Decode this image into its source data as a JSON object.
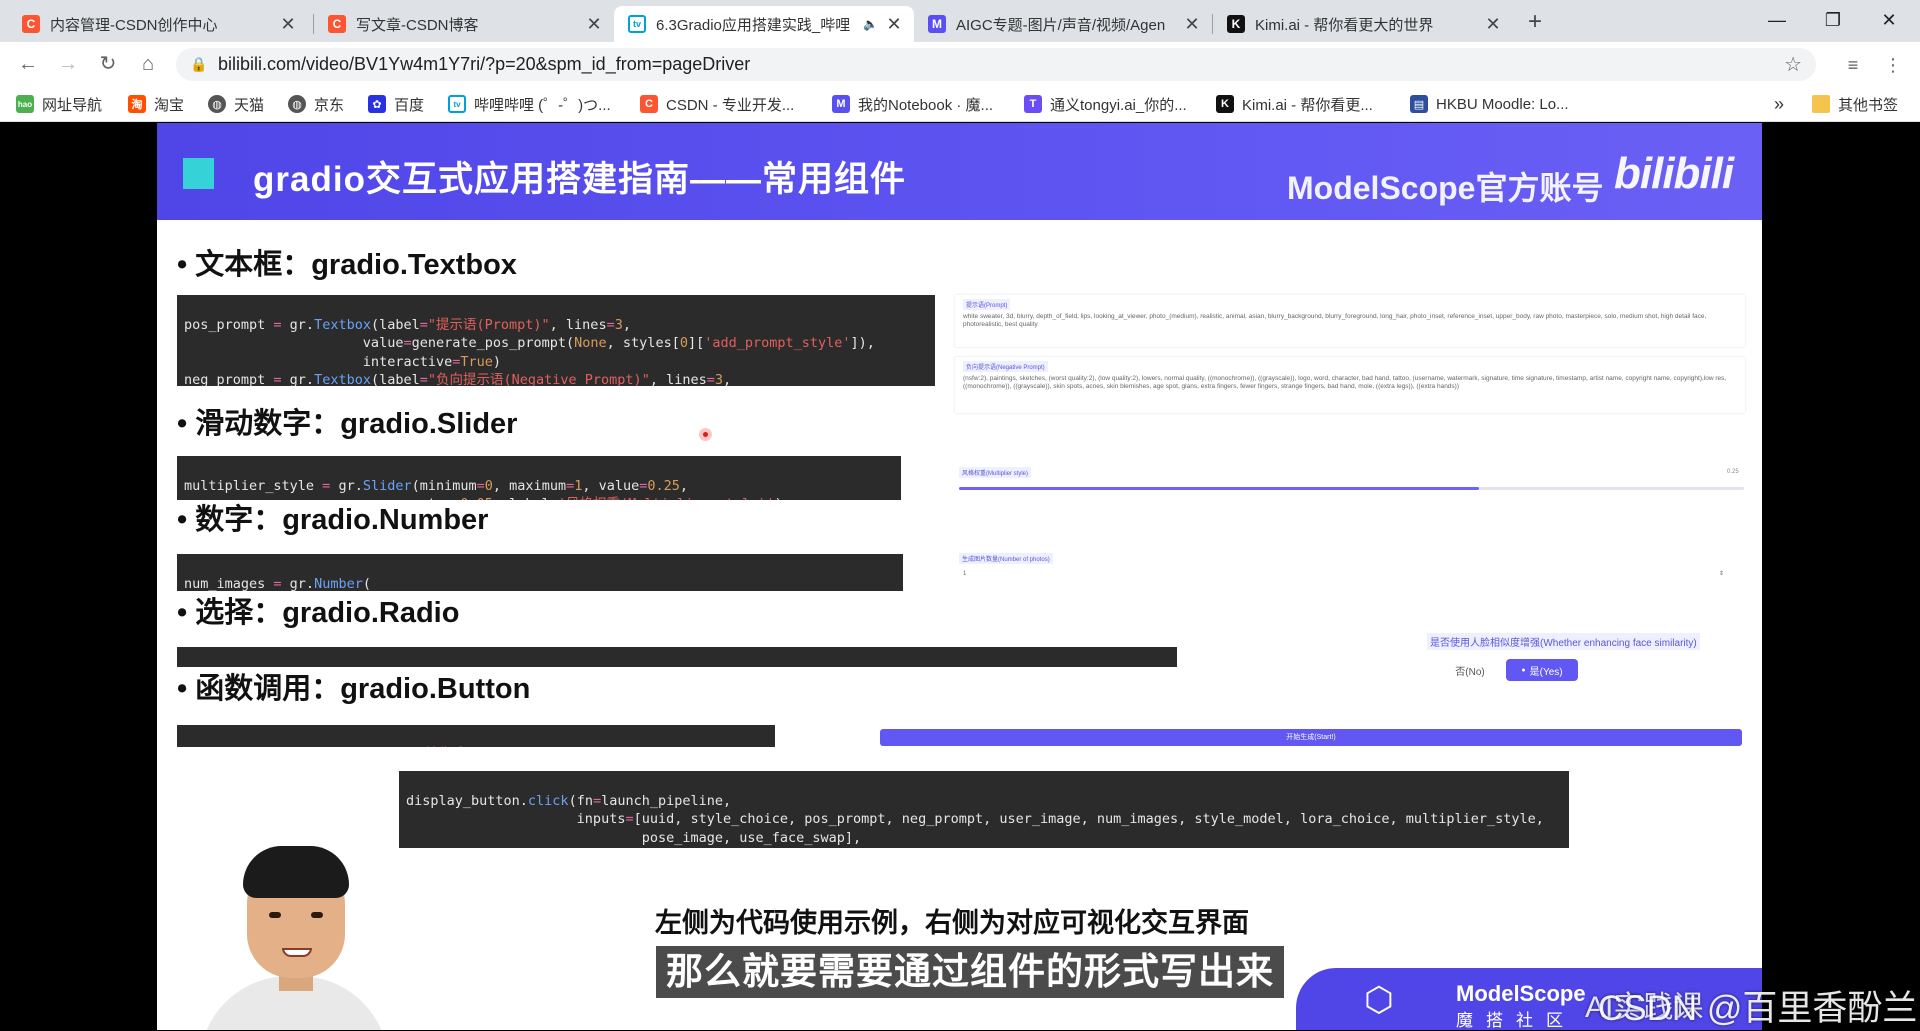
{
  "browser": {
    "tabs": [
      {
        "label": "内容管理-CSDN创作中心",
        "favicon": "C",
        "color": "#fc5531",
        "active": false
      },
      {
        "label": "写文章-CSDN博客",
        "favicon": "C",
        "color": "#fc5531",
        "active": false
      },
      {
        "label": "6.3Gradio应用搭建实践_哔哩",
        "favicon": "tv",
        "color": "#00a1d6",
        "active": true
      },
      {
        "label": "AIGC专题-图片/声音/视频/Agen",
        "favicon": "M",
        "color": "#5a4ff0",
        "active": false
      },
      {
        "label": "Kimi.ai - 帮你看更大的世界",
        "favicon": "K",
        "color": "#111111",
        "active": false
      }
    ],
    "new_tab": "+",
    "window_controls": {
      "minimize": "—",
      "maximize": "❐",
      "close": "✕"
    },
    "url": "bilibili.com/video/BV1Yw4m1Y7ri/?p=20&spm_id_from=pageDriver",
    "bookmarks": [
      {
        "label": "网址导航",
        "color": "#4caf50",
        "icon": "hao"
      },
      {
        "label": "淘宝",
        "color": "#ff5000",
        "icon": "淘"
      },
      {
        "label": "天猫",
        "color": "#555555",
        "icon": "globe"
      },
      {
        "label": "京东",
        "color": "#555555",
        "icon": "globe"
      },
      {
        "label": "百度",
        "color": "#2932e1",
        "icon": "paw"
      },
      {
        "label": "哔哩哔哩 (゜-゜)つ...",
        "color": "#00a1d6",
        "icon": "tv"
      },
      {
        "label": "CSDN - 专业开发...",
        "color": "#fc5531",
        "icon": "C"
      },
      {
        "label": "我的Notebook · 魔...",
        "color": "#5a4ff0",
        "icon": "M"
      },
      {
        "label": "通义tongyi.ai_你的...",
        "color": "#6b4cf6",
        "icon": "T"
      },
      {
        "label": "Kimi.ai - 帮你看更...",
        "color": "#111111",
        "icon": "K"
      },
      {
        "label": "HKBU Moodle: Lo...",
        "color": "#2d4f9e",
        "icon": "book"
      }
    ],
    "bookmarks_more": "»",
    "other_bookmarks": "其他书签"
  },
  "slide": {
    "title": "gradio交互式应用搭建指南——常用组件",
    "brand": "ModelScope官方账号",
    "bili_logo": "bilibili",
    "sections": [
      {
        "title": "• 文本框：gradio.Textbox"
      },
      {
        "title": "• 滑动数字：gradio.Slider"
      },
      {
        "title": "• 数字：gradio.Number"
      },
      {
        "title": "• 选择：gradio.Radio"
      },
      {
        "title": "• 函数调用：gradio.Button"
      }
    ],
    "preview": {
      "textbox_pos_label": "提示语(Prompt)",
      "textbox_pos_value": "white sweater, 3d, blurry, depth_of_field, lips, looking_at_viewer, photo_(medium), realistic, animal, asian, blurry_background, blurry_foreground, long_hair, photo_inset, reference_inset, upper_body, raw photo, masterpiece, solo, medium shot, high detail face, photorealistic, best quality",
      "textbox_neg_label": "负向提示语(Negative Prompt)",
      "textbox_neg_value": "(nsfw:2), paintings, sketches, (worst quality:2), (low quality:2), lowers, normal quality, ((monochrome)), ((grayscale)), logo, word, character, bad hand, tattoo, (username, watermark, signature, time signature, timestamp, artist name, copyright name, copyright),low res, ((monochrome)), ((grayscale)), skin spots, acnes, skin blemishes, age spot, glans, extra fingers, fewer fingers, strange fingers, bad hand, mole, ((extra legs)), ((extra hands))",
      "slider_label": "风格权重(Multiplier style)",
      "slider_value": "0.25",
      "slider_min": 0,
      "slider_max": 1,
      "number_label": "生成图片数量(Number of photos)",
      "number_value": "1",
      "radio_label": "是否使用人脸相似度增强(Whether enhancing face similarity)",
      "radio_no": "否(No)",
      "radio_yes": "是(Yes)",
      "radio_selected": "是(Yes)",
      "button_label": "开始生成(Start!)"
    },
    "subtitle_top": "左侧为代码使用示例，右侧为对应可视化交互界面",
    "subtitle_main": "那么就要需要通过组件的形式写出来",
    "modelscope_badge": {
      "name": "ModelScope",
      "sub": "魔搭社区"
    },
    "watermark": "CSDN @百里香酚兰",
    "watermark_overlap": "AI实践课"
  },
  "colors": {
    "slide_header": "#5a4ff0",
    "accent_square": "#35d3d8",
    "code_bg": "#2b2b2b",
    "primary_button": "#6157f2"
  }
}
